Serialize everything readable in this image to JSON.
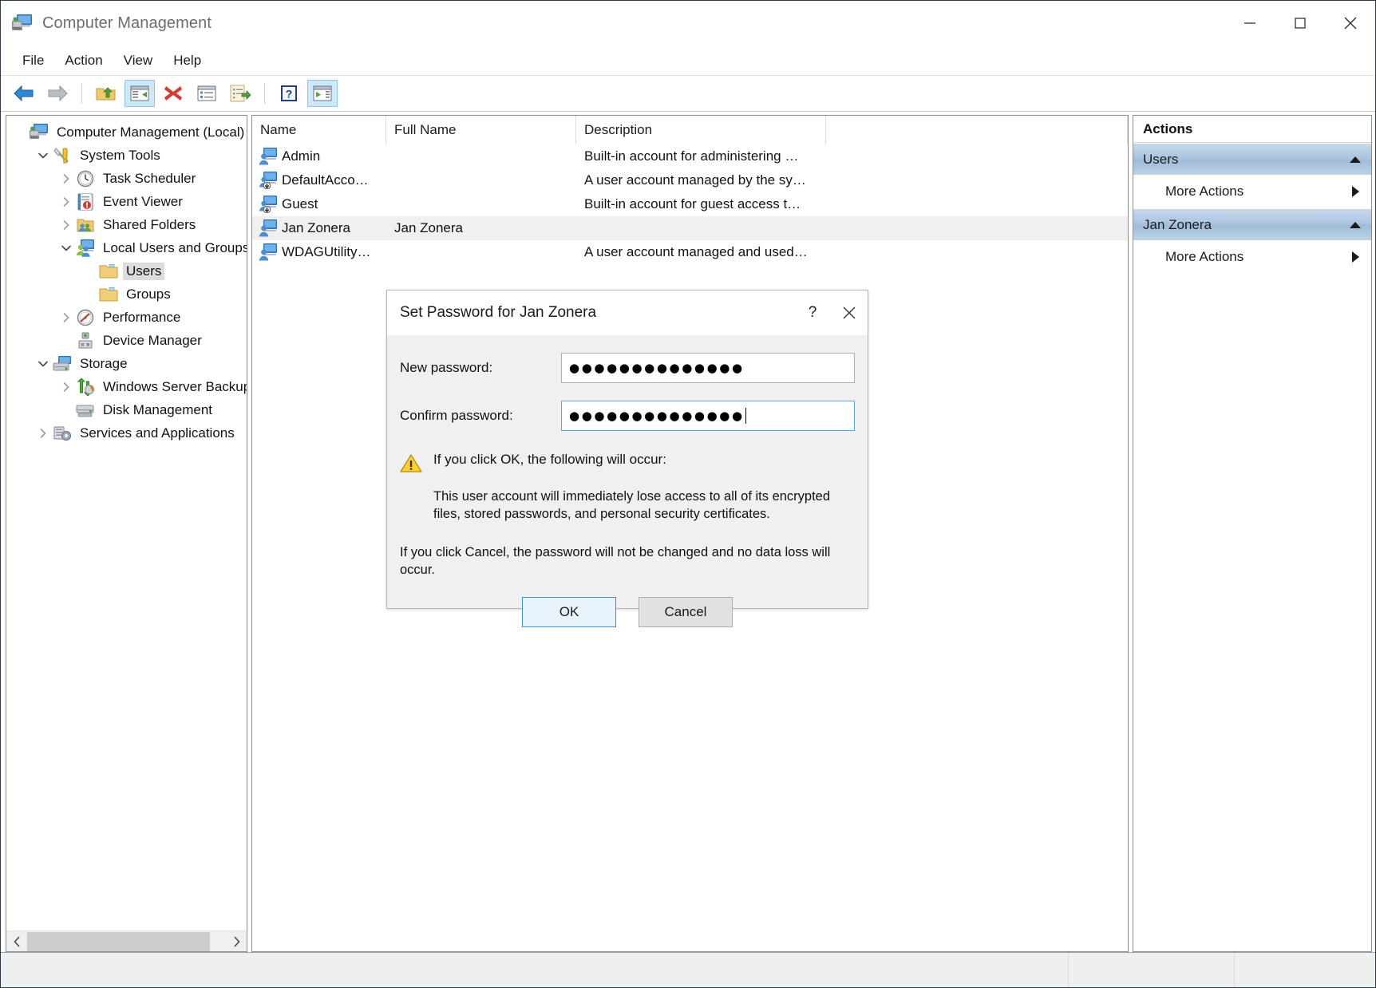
{
  "window": {
    "title": "Computer Management",
    "icon": "computer-management-icon",
    "controls": {
      "minimize": "minimize-icon",
      "maximize": "maximize-icon",
      "close": "close-icon"
    }
  },
  "menubar": {
    "items": [
      "File",
      "Action",
      "View",
      "Help"
    ]
  },
  "toolbar": {
    "buttons": [
      {
        "name": "back-button",
        "icon": "back-arrow-icon",
        "active": false
      },
      {
        "name": "forward-button",
        "icon": "forward-arrow-icon",
        "active": false
      },
      {
        "name": "up-one-level-button",
        "icon": "folder-up-icon",
        "active": false
      },
      {
        "name": "show-hide-console-tree-button",
        "icon": "console-tree-icon",
        "active": true
      },
      {
        "name": "delete-button",
        "icon": "red-x-icon",
        "active": false
      },
      {
        "name": "properties-button",
        "icon": "properties-icon",
        "active": false
      },
      {
        "name": "export-list-button",
        "icon": "export-list-icon",
        "active": false
      },
      {
        "name": "help-button",
        "icon": "question-mark-icon",
        "active": false
      },
      {
        "name": "show-hide-action-pane-button",
        "icon": "action-pane-icon",
        "active": true
      }
    ]
  },
  "tree": {
    "nodes": [
      {
        "label": "Computer Management (Local)",
        "depth": 0,
        "twisty": "none",
        "icon": "computer-icon",
        "selected": false
      },
      {
        "label": "System Tools",
        "depth": 1,
        "twisty": "open",
        "icon": "system-tools-icon",
        "selected": false
      },
      {
        "label": "Task Scheduler",
        "depth": 2,
        "twisty": "closed",
        "icon": "clock-icon",
        "selected": false
      },
      {
        "label": "Event Viewer",
        "depth": 2,
        "twisty": "closed",
        "icon": "event-viewer-icon",
        "selected": false
      },
      {
        "label": "Shared Folders",
        "depth": 2,
        "twisty": "closed",
        "icon": "shared-folders-icon",
        "selected": false
      },
      {
        "label": "Local Users and Groups",
        "depth": 2,
        "twisty": "open",
        "icon": "users-groups-icon",
        "selected": false
      },
      {
        "label": "Users",
        "depth": 3,
        "twisty": "none",
        "icon": "folder-icon",
        "selected": true
      },
      {
        "label": "Groups",
        "depth": 3,
        "twisty": "none",
        "icon": "folder-icon",
        "selected": false
      },
      {
        "label": "Performance",
        "depth": 2,
        "twisty": "closed",
        "icon": "performance-icon",
        "selected": false
      },
      {
        "label": "Device Manager",
        "depth": 2,
        "twisty": "none",
        "icon": "device-manager-icon",
        "selected": false
      },
      {
        "label": "Storage",
        "depth": 1,
        "twisty": "open",
        "icon": "storage-icon",
        "selected": false
      },
      {
        "label": "Windows Server Backup",
        "depth": 2,
        "twisty": "closed",
        "icon": "server-backup-icon",
        "selected": false
      },
      {
        "label": "Disk Management",
        "depth": 2,
        "twisty": "none",
        "icon": "disk-management-icon",
        "selected": false
      },
      {
        "label": "Services and Applications",
        "depth": 1,
        "twisty": "closed",
        "icon": "services-icon",
        "selected": false
      }
    ],
    "scrollbar": {
      "left_arrow": "chevron-left-icon",
      "right_arrow": "chevron-right-icon"
    }
  },
  "list": {
    "columns": [
      "Name",
      "Full Name",
      "Description"
    ],
    "rows": [
      {
        "name": "Admin",
        "full_name": "",
        "description": "Built-in account for administering …",
        "icon": "user-icon",
        "selected": false
      },
      {
        "name": "DefaultAcco…",
        "full_name": "",
        "description": "A user account managed by the sy…",
        "icon": "user-disabled-icon",
        "selected": false
      },
      {
        "name": "Guest",
        "full_name": "",
        "description": "Built-in account for guest access t…",
        "icon": "user-disabled-icon",
        "selected": false
      },
      {
        "name": "Jan Zonera",
        "full_name": "Jan Zonera",
        "description": "",
        "icon": "user-icon",
        "selected": true
      },
      {
        "name": "WDAGUtility…",
        "full_name": "",
        "description": "A user account managed and used…",
        "icon": "user-icon",
        "selected": false
      }
    ]
  },
  "actions": {
    "title": "Actions",
    "groups": [
      {
        "name": "Users",
        "collapse_icon": "chevron-up-icon",
        "items": [
          {
            "label": "More Actions",
            "submenu_icon": "triangle-right-icon"
          }
        ]
      },
      {
        "name": "Jan Zonera",
        "collapse_icon": "chevron-up-icon",
        "items": [
          {
            "label": "More Actions",
            "submenu_icon": "triangle-right-icon"
          }
        ]
      }
    ]
  },
  "dialog": {
    "title": "Set Password for Jan Zonera",
    "help_button": "?",
    "close_button": "close-icon",
    "fields": [
      {
        "label": "New password:",
        "value": "●●●●●●●●●●●●●●",
        "focused": false
      },
      {
        "label": "Confirm password:",
        "value": "●●●●●●●●●●●●●●",
        "focused": true
      }
    ],
    "warning_icon": "warning-triangle-icon",
    "warning_heading": "If you click OK, the following will occur:",
    "warning_body": "This user account will immediately lose access to all of its encrypted files, stored passwords, and personal security certificates.",
    "warning_body2": "If you click Cancel, the password will not be changed and no data loss will occur.",
    "ok_label": "OK",
    "cancel_label": "Cancel"
  },
  "colors": {
    "accent_blue": "#3c8fd0",
    "selection_gray": "#f0f0f0",
    "actions_group_blue": "#a9c3de",
    "warning_yellow": "#ffd02e"
  }
}
